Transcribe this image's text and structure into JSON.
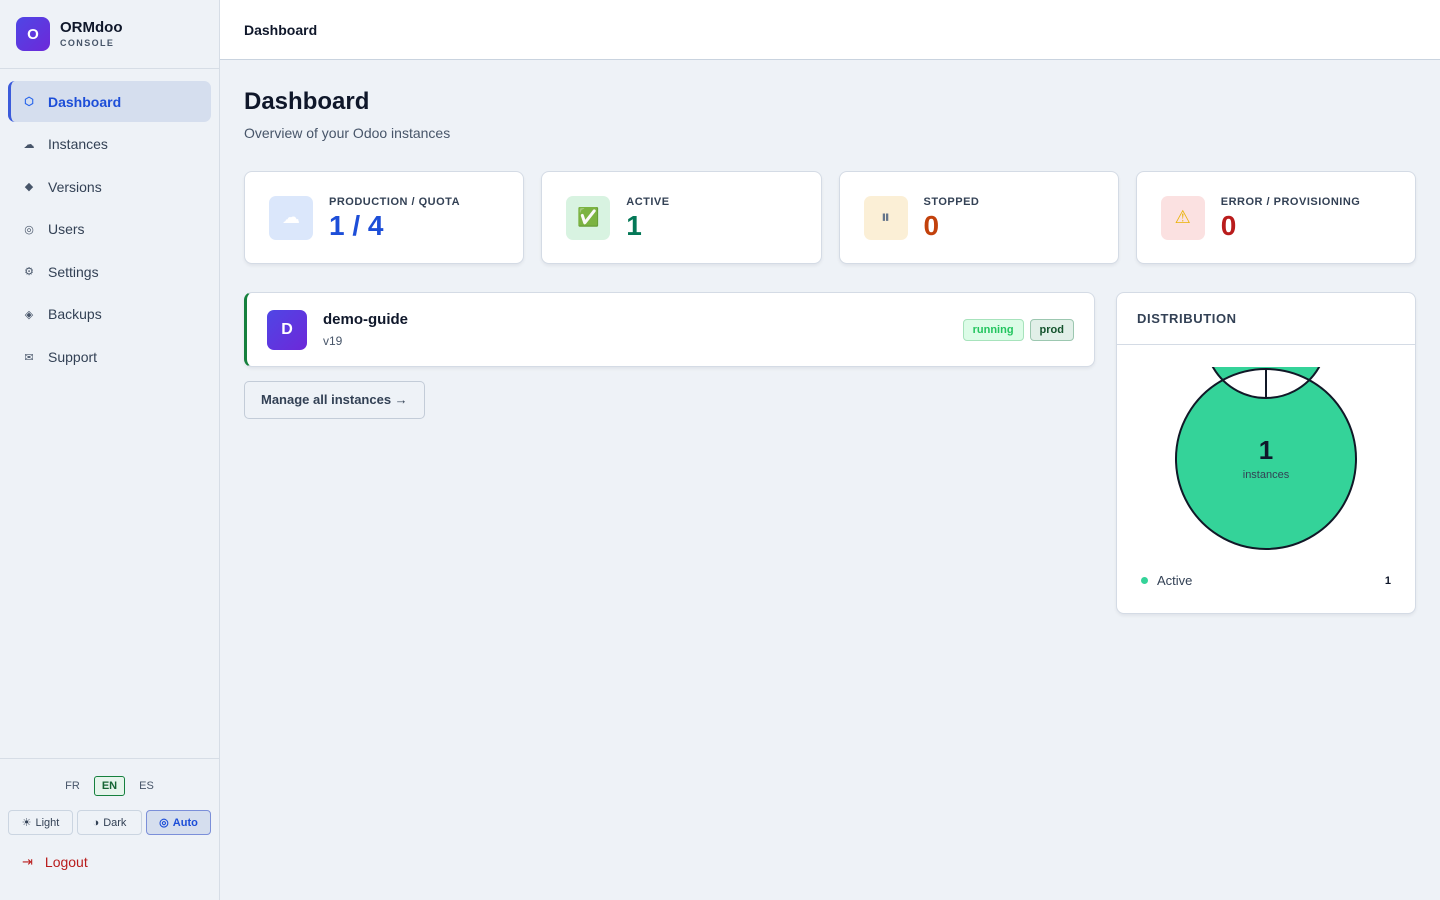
{
  "brand": {
    "logo_letter": "O",
    "name": "ORMdoo",
    "sub": "CONSOLE"
  },
  "nav": [
    {
      "label": "Dashboard",
      "icon": "hexagon-icon",
      "glyph": "⬡",
      "active": true
    },
    {
      "label": "Instances",
      "icon": "cloud-icon",
      "glyph": "☁"
    },
    {
      "label": "Versions",
      "icon": "diamond-icon",
      "glyph": "◆"
    },
    {
      "label": "Users",
      "icon": "user-circle-icon",
      "glyph": "◎"
    },
    {
      "label": "Settings",
      "icon": "gear-icon",
      "glyph": "⚙"
    },
    {
      "label": "Backups",
      "icon": "backup-icon",
      "glyph": "◈"
    },
    {
      "label": "Support",
      "icon": "mail-icon",
      "glyph": "✉"
    }
  ],
  "languages": [
    "FR",
    "EN",
    "ES"
  ],
  "active_language": "EN",
  "themes": [
    {
      "label": "Light",
      "glyph": "☀"
    },
    {
      "label": "Dark",
      "glyph": "◑"
    },
    {
      "label": "Auto",
      "glyph": "◎"
    }
  ],
  "active_theme": "Auto",
  "logout": {
    "label": "Logout",
    "glyph": "⇥"
  },
  "topbar": {
    "title": "Dashboard"
  },
  "page": {
    "title": "Dashboard",
    "subtitle": "Overview of your Odoo instances"
  },
  "stats": [
    {
      "label": "PRODUCTION / QUOTA",
      "value": "1 / 4",
      "icon": "cloud-icon",
      "glyph": "☁",
      "icon_bg": "#dbe7fb",
      "icon_color": "#ffffff",
      "value_color": "#1d4ed8"
    },
    {
      "label": "ACTIVE",
      "value": "1",
      "icon": "check-icon",
      "glyph": "✅",
      "icon_bg": "#d8f3e1",
      "icon_color": "#16a34a",
      "value_color": "#047857"
    },
    {
      "label": "STOPPED",
      "value": "0",
      "icon": "pause-icon",
      "glyph": "⏸",
      "icon_bg": "#fbefd6",
      "icon_color": "#64748b",
      "value_color": "#c2410c"
    },
    {
      "label": "ERROR / PROVISIONING",
      "value": "0",
      "icon": "warning-icon",
      "glyph": "⚠",
      "icon_bg": "#fbe1e1",
      "icon_color": "#eab308",
      "value_color": "#b91c1c"
    }
  ],
  "instance": {
    "avatar_letter": "D",
    "name": "demo-guide",
    "version": "v19",
    "status": "running",
    "env": "prod"
  },
  "manage_button": "Manage all instances →",
  "distribution": {
    "title": "DISTRIBUTION",
    "total": "1",
    "unit": "instances"
  },
  "chart_data": {
    "type": "pie",
    "donut": true,
    "categories": [
      "Active"
    ],
    "values": [
      1
    ],
    "colors": [
      "#34d399"
    ],
    "legend_position": "bottom"
  }
}
